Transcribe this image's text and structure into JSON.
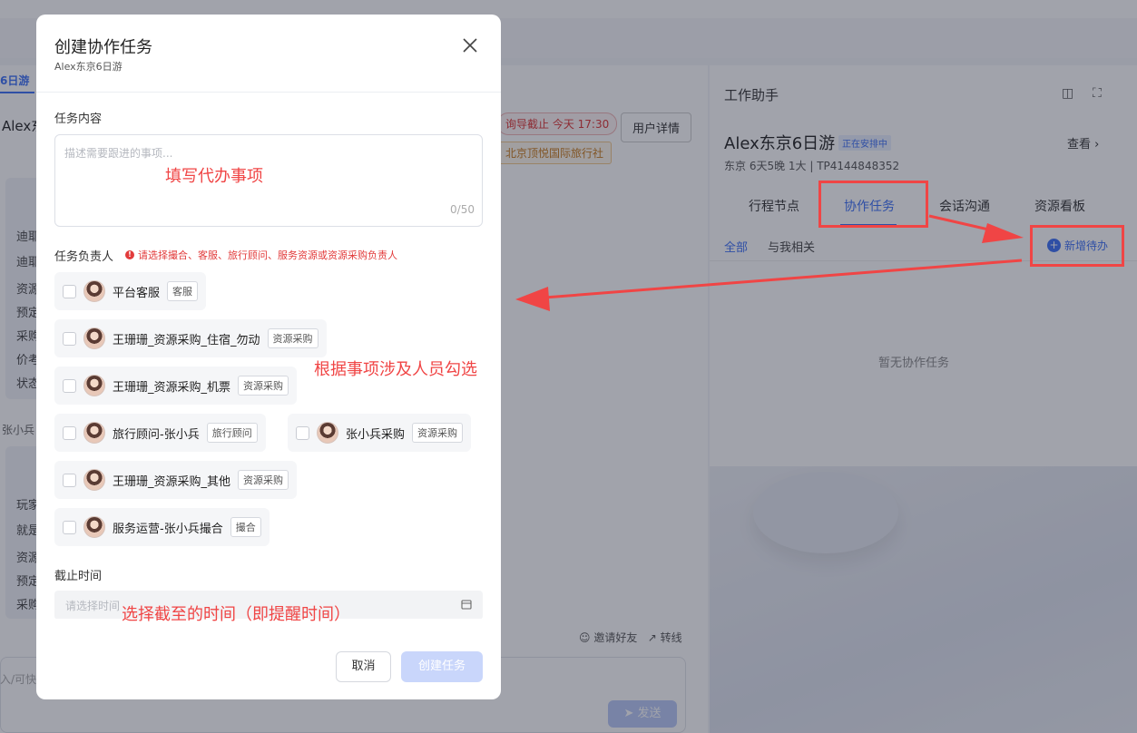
{
  "modal": {
    "title": "创建协作任务",
    "subtitle": "Alex东京6日游",
    "content_label": "任务内容",
    "content_placeholder": "描述需要跟进的事项...",
    "content_count": "0/50",
    "assignee_label": "任务负责人",
    "assignee_error": "请选择撮合、客服、旅行顾问、服务资源或资源采购负责人",
    "assignees": [
      {
        "name": "平台客服",
        "tag": "客服"
      },
      {
        "name": "王珊珊_资源采购_住宿_勿动",
        "tag": "资源采购"
      },
      {
        "name": "王珊珊_资源采购_机票",
        "tag": "资源采购"
      },
      {
        "name": "旅行顾问-张小兵",
        "tag": "旅行顾问"
      },
      {
        "name": "张小兵采购",
        "tag": "资源采购"
      },
      {
        "name": "王珊珊_资源采购_其他",
        "tag": "资源采购"
      },
      {
        "name": "服务运营-张小兵撮合",
        "tag": "撮合"
      }
    ],
    "deadline_label": "截止时间",
    "deadline_placeholder": "请选择时间",
    "cancel_label": "取消",
    "create_label": "创建任务"
  },
  "annotations": {
    "fill_todo": "填写代办事项",
    "check_people": "根据事项涉及人员勾选",
    "select_time": "选择截至的时间（即提醒时间）",
    "color": "#f04545"
  },
  "background": {
    "tab": "6日游",
    "alex": "Alex东",
    "tag_red": "询导截止 今天 17:30",
    "tag_orange": "北京顶悦国际旅行社",
    "user_detail": "用户详情",
    "left_lines": [
      "迪耶",
      "迪耶",
      "资源",
      "预定",
      "采购",
      "价考",
      "状态",
      "玩家",
      "就是",
      "资源",
      "预定",
      "采购"
    ],
    "small_name": "张小兵",
    "invite": "邀请好友",
    "transfer": "转线",
    "input_placeholder": "入/可快",
    "send": "发送",
    "assistant_title": "工作助手",
    "trip_title": "Alex东京6日游",
    "trip_badge": "正在安排中",
    "view": "查看",
    "trip_sub": "东京 6天5晚 1大 | TP4144848352",
    "tabs": [
      "行程节点",
      "协作任务",
      "会话沟通",
      "资源看板"
    ],
    "filters": [
      "全部",
      "与我相关"
    ],
    "new_todo": "新增待办",
    "empty": "暂无协作任务"
  }
}
